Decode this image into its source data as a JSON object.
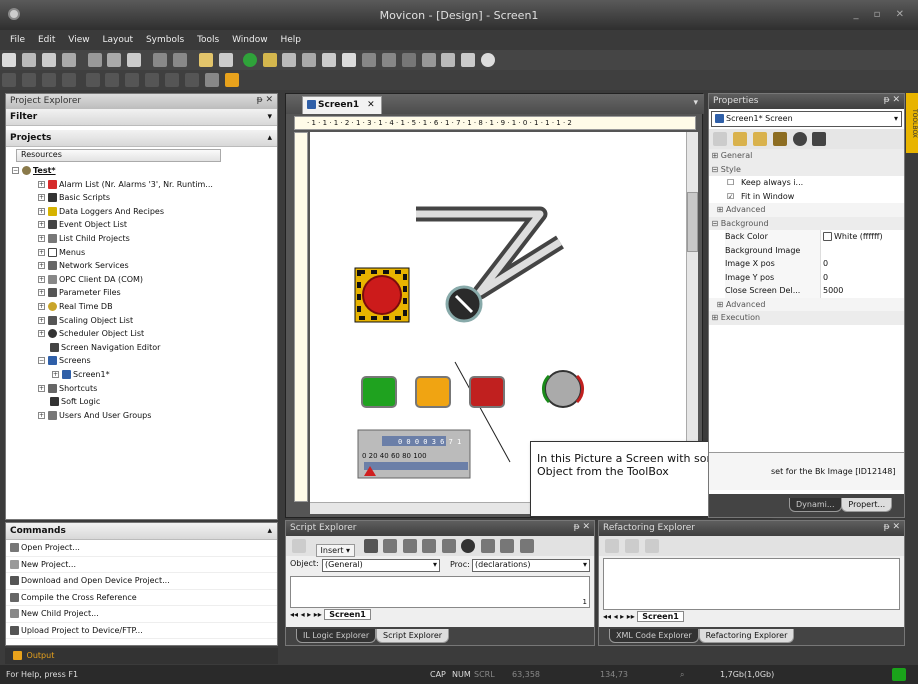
{
  "window": {
    "title": "Movicon - [Design] - Screen1"
  },
  "menu": [
    "File",
    "Edit",
    "View",
    "Layout",
    "Symbols",
    "Tools",
    "Window",
    "Help"
  ],
  "project_explorer": {
    "title": "Project Explorer",
    "filter_label": "Filter",
    "projects_label": "Projects",
    "resources_header": "Resources",
    "tree": [
      {
        "label": "Test*",
        "icon": "gear-icon",
        "bold": true
      },
      {
        "label": "Alarm List (Nr. Alarms '3', Nr. Runtim...",
        "icon": "alarm-icon"
      },
      {
        "label": "Basic Scripts",
        "icon": "script-icon"
      },
      {
        "label": "Data Loggers And Recipes",
        "icon": "database-icon"
      },
      {
        "label": "Event Object List",
        "icon": "event-icon"
      },
      {
        "label": "List Child Projects",
        "icon": "child-project-icon"
      },
      {
        "label": "Menus",
        "icon": "menu-icon"
      },
      {
        "label": "Network Services",
        "icon": "network-icon"
      },
      {
        "label": "OPC Client DA (COM)",
        "icon": "opc-icon"
      },
      {
        "label": "Parameter Files",
        "icon": "parameter-icon"
      },
      {
        "label": "Real Time DB",
        "icon": "realtime-db-icon"
      },
      {
        "label": "Scaling Object List",
        "icon": "scaling-icon"
      },
      {
        "label": "Scheduler Object List",
        "icon": "scheduler-icon"
      },
      {
        "label": "Screen Navigation Editor",
        "icon": "navigation-icon"
      },
      {
        "label": "Screens",
        "icon": "screen-icon"
      },
      {
        "label": "Screen1*",
        "icon": "screen-icon"
      },
      {
        "label": "Shortcuts",
        "icon": "shortcut-icon"
      },
      {
        "label": "Soft Logic",
        "icon": "softlogic-icon"
      },
      {
        "label": "Users And User Groups",
        "icon": "users-icon"
      }
    ]
  },
  "commands": {
    "title": "Commands",
    "items": [
      "Open Project...",
      "New Project...",
      "Download and Open Device Project...",
      "Compile the Cross Reference",
      "New Child Project...",
      "Upload Project to Device/FTP..."
    ]
  },
  "document": {
    "tab": "Screen1",
    "ruler": "· 1 · 1 · 1 · 2 · 1 · 3 · 1 · 4 · 1 · 5 · 1 · 6 · 1 · 7 · 1 · 8 · 1 · 9 · 1 · 0 · 1 · 1 · 1 · 2",
    "callout": "In this Picture a Screen with some Object from the ToolBox",
    "meter_ticks": "0  20  40  60  80  100",
    "meter_digits": "0 0 0 0 3 6 7 1"
  },
  "properties": {
    "title": "Properties",
    "selector": "Screen1* Screen",
    "rows": [
      {
        "type": "group",
        "label": "General"
      },
      {
        "type": "group",
        "label": "Style"
      },
      {
        "type": "check",
        "label": "Keep always i...",
        "checked": false
      },
      {
        "type": "check",
        "label": "Fit in Window",
        "checked": true
      },
      {
        "type": "sub",
        "label": "Advanced"
      },
      {
        "type": "group",
        "label": "Background"
      },
      {
        "type": "kv",
        "key": "Back Color",
        "value": "White (ffffff)"
      },
      {
        "type": "kv",
        "key": "Background Image",
        "value": ""
      },
      {
        "type": "kv",
        "key": "Image X pos",
        "value": "0"
      },
      {
        "type": "kv",
        "key": "Image Y pos",
        "value": "0"
      },
      {
        "type": "kv",
        "key": "Close Screen Del...",
        "value": "5000"
      },
      {
        "type": "sub",
        "label": "Advanced"
      },
      {
        "type": "group",
        "label": "Execution"
      }
    ],
    "description": "set for the Bk Image [ID12148]",
    "tabs": [
      "Dynami...",
      "Propert..."
    ],
    "side_tab": "TOOLBOX"
  },
  "script_explorer": {
    "title": "Script Explorer",
    "insert_label": "Insert",
    "object_label": "Object:",
    "object_value": "(General)",
    "proc_label": "Proc:",
    "proc_value": "(declarations)",
    "line_number": "1",
    "sheet_tab": "Screen1",
    "tabs": [
      "IL Logic Explorer",
      "Script Explorer"
    ]
  },
  "refactoring_explorer": {
    "title": "Refactoring Explorer",
    "sheet_tab": "Screen1",
    "tabs": [
      "XML Code Explorer",
      "Refactoring Explorer"
    ]
  },
  "output": {
    "label": "Output"
  },
  "status": {
    "help": "For Help, press F1",
    "cap": "CAP",
    "num": "NUM",
    "scrl": "SCRL",
    "pos1": "63,358",
    "pos2": "134,73",
    "mem": "1,7Gb(1,0Gb)"
  }
}
